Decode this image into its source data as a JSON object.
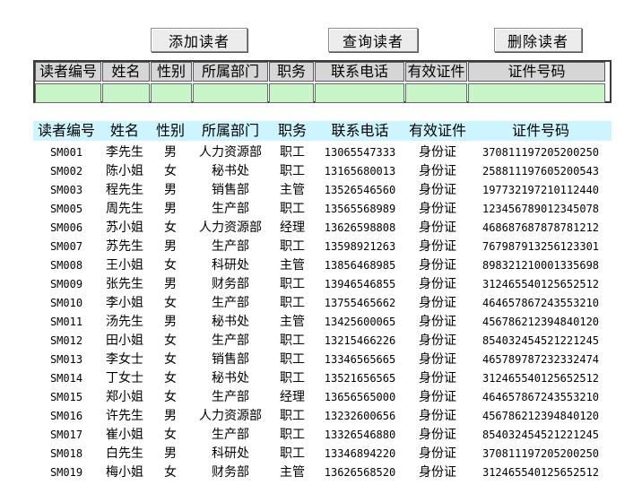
{
  "toolbar": {
    "add_label": "添加读者",
    "query_label": "查询读者",
    "delete_label": "删除读者"
  },
  "columns": [
    "读者编号",
    "姓名",
    "性别",
    "所属部门",
    "职务",
    "联系电话",
    "有效证件",
    "证件号码"
  ],
  "entry_values": [
    "",
    "",
    "",
    "",
    "",
    "",
    "",
    ""
  ],
  "rows": [
    [
      "SM001",
      "李先生",
      "男",
      "人力资源部",
      "职工",
      "13065547333",
      "身份证",
      "370811197205200250"
    ],
    [
      "SM002",
      "陈小姐",
      "女",
      "秘书处",
      "职工",
      "13165680013",
      "身份证",
      "258811197605200543"
    ],
    [
      "SM003",
      "程先生",
      "男",
      "销售部",
      "主管",
      "13526546560",
      "身份证",
      "197732197210112440"
    ],
    [
      "SM005",
      "周先生",
      "男",
      "生产部",
      "职工",
      "13565568989",
      "身份证",
      "123456789012345078"
    ],
    [
      "SM006",
      "苏小姐",
      "女",
      "人力资源部",
      "经理",
      "13626598808",
      "身份证",
      "468687687878781212"
    ],
    [
      "SM007",
      "苏先生",
      "男",
      "生产部",
      "职工",
      "13598921263",
      "身份证",
      "767987913256123301"
    ],
    [
      "SM008",
      "王小姐",
      "女",
      "科研处",
      "主管",
      "13856468985",
      "身份证",
      "898321210001335698"
    ],
    [
      "SM009",
      "张先生",
      "男",
      "财务部",
      "职工",
      "13946546855",
      "身份证",
      "312465540125652512"
    ],
    [
      "SM010",
      "李小姐",
      "女",
      "生产部",
      "职工",
      "13755465662",
      "身份证",
      "464657867243553210"
    ],
    [
      "SM011",
      "汤先生",
      "男",
      "秘书处",
      "主管",
      "13425600065",
      "身份证",
      "456786212394840120"
    ],
    [
      "SM012",
      "田小姐",
      "女",
      "生产部",
      "职工",
      "13215466226",
      "身份证",
      "854032454521221245"
    ],
    [
      "SM013",
      "李女士",
      "女",
      "销售部",
      "职工",
      "13346565665",
      "身份证",
      "465789787232332474"
    ],
    [
      "SM014",
      "丁女士",
      "女",
      "秘书处",
      "职工",
      "13521656565",
      "身份证",
      "312465540125652512"
    ],
    [
      "SM015",
      "郑小姐",
      "女",
      "生产部",
      "经理",
      "13656565000",
      "身份证",
      "464657867243553210"
    ],
    [
      "SM016",
      "许先生",
      "男",
      "人力资源部",
      "职工",
      "13232600656",
      "身份证",
      "456786212394840120"
    ],
    [
      "SM017",
      "崔小姐",
      "女",
      "生产部",
      "职工",
      "13326546880",
      "身份证",
      "854032454521221245"
    ],
    [
      "SM018",
      "白先生",
      "男",
      "科研处",
      "职工",
      "13346894220",
      "身份证",
      "370811197205200250"
    ],
    [
      "SM019",
      "梅小姐",
      "女",
      "财务部",
      "主管",
      "13626568520",
      "身份证",
      "312465540125652512"
    ]
  ]
}
